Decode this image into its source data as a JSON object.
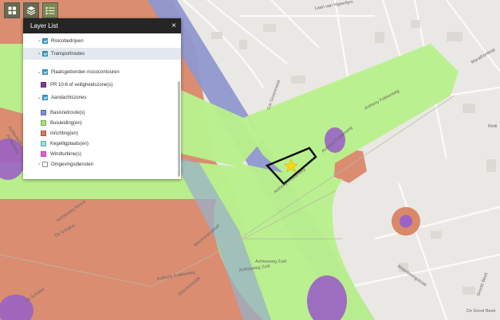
{
  "toolbar": {
    "icons": [
      "basemap-gallery-icon",
      "layers-icon",
      "legend-icon"
    ]
  },
  "layer_list": {
    "title": "Layer List",
    "close_glyph": "×",
    "more_glyph": "•••",
    "items": [
      {
        "label": "Risicobedrijven",
        "checked": true,
        "level": 0,
        "caret": "›",
        "has_more": true
      },
      {
        "label": "Transportroutes",
        "checked": true,
        "level": 0,
        "caret": "›",
        "has_more": true,
        "highlighted": true
      },
      {
        "label": "Plaatsgebonden risicocontouren",
        "checked": true,
        "level": 0,
        "caret": "⌄",
        "has_more": true
      },
      {
        "label": "PR 10-6 of veiligheidszone(s)",
        "swatch": "#7b3f96",
        "level": 1
      },
      {
        "label": "Aandachtszones",
        "checked": true,
        "level": 0,
        "caret": "⌄",
        "has_more": true
      },
      {
        "label": "Basisnetroute(s)",
        "swatch": "#7b8fd0",
        "level": 1
      },
      {
        "label": "Buisleiding(en)",
        "swatch": "#a9e07a",
        "level": 1
      },
      {
        "label": "Inrichting(en)",
        "swatch": "#d9785a",
        "level": 1
      },
      {
        "label": "Kegelligplaats(en)",
        "swatch": "#8ee6d8",
        "level": 1
      },
      {
        "label": "Windturbine(s)",
        "swatch": "#e85ed6",
        "level": 1
      },
      {
        "label": "Omgevingsdiensten",
        "checked": false,
        "level": 0,
        "caret": "›",
        "has_more": true
      }
    ]
  },
  "map": {
    "colors": {
      "background": "#e9e8e4",
      "inrichting": "#d9886a",
      "buisleiding": "#b8f08c",
      "basisnet": "#8f98cf",
      "pr_zone": "#9a63c4",
      "outline": "#111111",
      "marker": "#f2d91a"
    },
    "street_labels": [
      "Anthony Fokkerweg",
      "Anthony Fokkerweg",
      "Anthony Fokkerweg",
      "Anthony Fokkerweg",
      "Achtseweg Zuid",
      "Achtseweg Noord",
      "Achtseweg Noord",
      "Achtseweg Zuid",
      "De Schakel",
      "De Schakel",
      "Achtseweg",
      "Meerhovendreef",
      "Oirschotsedijk",
      "Waterkeringstraat",
      "Laan van Hyperlijen",
      "Cor Groeneveld",
      "Marathonloop",
      "De Groot Beek",
      "Groote Beek",
      "Redi"
    ]
  }
}
